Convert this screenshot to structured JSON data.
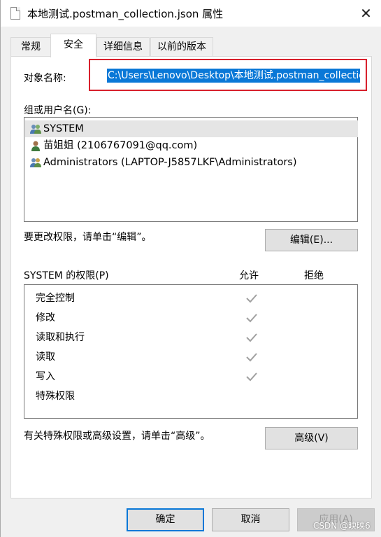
{
  "window": {
    "title": "本地测试.postman_collection.json 属性",
    "close_label": "✕"
  },
  "tabs": [
    {
      "label": "常规",
      "active": false
    },
    {
      "label": "安全",
      "active": true
    },
    {
      "label": "详细信息",
      "active": false
    },
    {
      "label": "以前的版本",
      "active": false
    }
  ],
  "security": {
    "object_name_label": "对象名称:",
    "object_name_value": "C:\\Users\\Lenovo\\Desktop\\本地测试.postman_collection.json",
    "groups_label": "组或用户名(G):",
    "groups": [
      {
        "name": "SYSTEM",
        "icon": "group-icon",
        "selected": true
      },
      {
        "name": "苗姐姐 (2106767091@qq.com)",
        "icon": "user-icon",
        "selected": false
      },
      {
        "name": "Administrators (LAPTOP-J5857LKF\\Administrators)",
        "icon": "group-icon",
        "selected": false
      }
    ],
    "edit_hint": "要更改权限，请单击“编辑”。",
    "edit_button": "编辑(E)...",
    "permissions_label": "SYSTEM 的权限(P)",
    "allow_header": "允许",
    "deny_header": "拒绝",
    "permissions": [
      {
        "name": "完全控制",
        "allow": true,
        "deny": false
      },
      {
        "name": "修改",
        "allow": true,
        "deny": false
      },
      {
        "name": "读取和执行",
        "allow": true,
        "deny": false
      },
      {
        "name": "读取",
        "allow": true,
        "deny": false
      },
      {
        "name": "写入",
        "allow": true,
        "deny": false
      },
      {
        "name": "特殊权限",
        "allow": false,
        "deny": false
      }
    ],
    "advanced_hint": "有关特殊权限或高级设置，请单击“高级”。",
    "advanced_button": "高级(V)"
  },
  "footer": {
    "ok_button": "确定",
    "cancel_button": "取消",
    "apply_button": "应用(A)"
  },
  "watermark": "CSDN @映映6",
  "colors": {
    "highlight": "#0a78d7",
    "annotation_red": "#d8202c",
    "check_gray": "#a0a0a0"
  }
}
